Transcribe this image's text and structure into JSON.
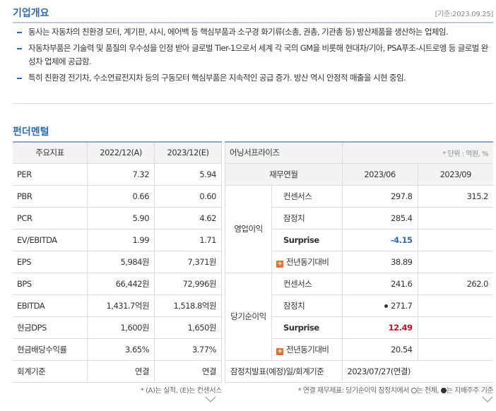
{
  "overview": {
    "title": "기업개요",
    "date": "[기준:2023.09.25]",
    "bullets": [
      "동사는 자동차의 친환경 모터, 계기판, 샤시, 에어백 등 핵심부품과 소구경 화기류(소총, 권총, 기관총 등) 방산제품을 생산하는 업체임.",
      "자동차부품은 기술력 및 품질의 우수성을 인정 받아 글로벌 Tier-1으로서 세계 각 국의 GM을 비롯해 현대차/기아, PSA푸조-시트로엥 등 글로벌 완성차 업체에 공급함.",
      "특히 친환경 전기차, 수소연료전지차 등의 구동모터 핵심부품은 지속적인 공급 증가. 방산 역시 안정적 매출을 시현 중임."
    ]
  },
  "fundamental": {
    "title": "펀더멘털",
    "headers": [
      "주요지표",
      "2022/12(A)",
      "2023/12(E)"
    ],
    "rows": [
      {
        "label": "PER",
        "a": "7.32",
        "e": "5.94"
      },
      {
        "label": "PBR",
        "a": "0.66",
        "e": "0.60"
      },
      {
        "label": "PCR",
        "a": "5.90",
        "e": "4.62"
      },
      {
        "label": "EV/EBITDA",
        "a": "1.99",
        "e": "1.71"
      },
      {
        "label": "EPS",
        "a": "5,984원",
        "e": "7,371원"
      },
      {
        "label": "BPS",
        "a": "66,442원",
        "e": "72,996원"
      },
      {
        "label": "EBITDA",
        "a": "1,431.7억원",
        "e": "1,518.8억원"
      },
      {
        "label": "현금DPS",
        "a": "1,600원",
        "e": "1,650원"
      },
      {
        "label": "현금배당수익률",
        "a": "3.65%",
        "e": "3.77%"
      },
      {
        "label": "회계기준",
        "a": "연결",
        "e": "연결"
      }
    ],
    "footnote": "* (A)는 실적, (E)는 컨센서스"
  },
  "surprise": {
    "title": "어닝서프라이즈",
    "unit": "* 단위 : 억원, %",
    "headers": [
      "재무연월",
      "2023/06",
      "2023/09"
    ],
    "groups": [
      {
        "name": "영업이익",
        "rows": [
          {
            "label": "컨센서스",
            "v1": "297.8",
            "v2": "315.2"
          },
          {
            "label": "잠정치",
            "v1": "285.4",
            "v2": ""
          },
          {
            "label": "Surprise",
            "v1": "-4.15",
            "v2": ""
          },
          {
            "label": "전년동기대비",
            "v1": "38.89",
            "v2": ""
          }
        ]
      },
      {
        "name": "당기순이익",
        "rows": [
          {
            "label": "컨센서스",
            "v1": "241.6",
            "v2": "262.0"
          },
          {
            "label": "잠정치",
            "v1": "271.7",
            "v2": ""
          },
          {
            "label": "Surprise",
            "v1": "12.49",
            "v2": ""
          },
          {
            "label": "전년동기대비",
            "v1": "20.54",
            "v2": ""
          }
        ]
      }
    ],
    "announce_label": "잠정치발표(예정)일/회계기준",
    "announce_value": "2023/07/27(연결)",
    "footnote_a": "* 연결 재무제표: 당기순이익 잠정치에서 ",
    "footnote_b": "는 전체, ",
    "footnote_c": "는 지배주주 기준",
    "colors": {
      "negative": "#2f6ab5",
      "positive": "#c8102e",
      "accent": "#2f6ab5",
      "plus": "#ef6c2a"
    }
  }
}
